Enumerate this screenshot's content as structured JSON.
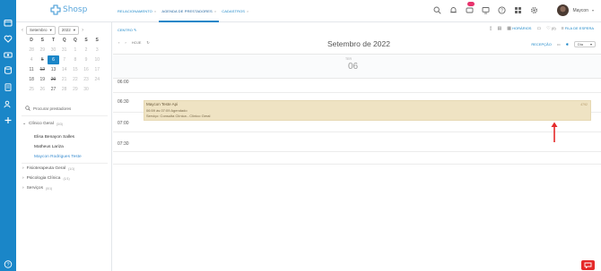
{
  "app": {
    "logo_text": "Shosp",
    "user_name": "Maycon"
  },
  "tabs": [
    {
      "label": "RELACIONAMENTO",
      "active": false
    },
    {
      "label": "AGENDA DE PRESTADORES",
      "active": true
    },
    {
      "label": "CADASTROS",
      "active": false
    }
  ],
  "top_icons": [
    "search-icon",
    "bell-icon",
    "chat-icon",
    "monitor-icon",
    "help-icon",
    "grid-icon",
    "settings-icon"
  ],
  "notification_badge": "",
  "rail_icons": [
    "calendar-icon",
    "heart-icon",
    "money-icon",
    "database-icon",
    "document-icon",
    "building-icon",
    "user-settings-icon",
    "plus-icon",
    "help-icon"
  ],
  "calendar": {
    "month": "Setembro",
    "year": "2022",
    "weekdays": [
      "D",
      "S",
      "T",
      "Q",
      "Q",
      "S",
      "S"
    ],
    "days": [
      {
        "d": "28",
        "cur": false
      },
      {
        "d": "29",
        "cur": false
      },
      {
        "d": "30",
        "cur": false
      },
      {
        "d": "31",
        "cur": false
      },
      {
        "d": "1",
        "cur": false
      },
      {
        "d": "2",
        "cur": false
      },
      {
        "d": "3",
        "cur": false
      },
      {
        "d": "4",
        "cur": false
      },
      {
        "d": "5",
        "cur": true,
        "strike": true
      },
      {
        "d": "6",
        "cur": true,
        "today": true
      },
      {
        "d": "7",
        "cur": false
      },
      {
        "d": "8",
        "cur": false
      },
      {
        "d": "9",
        "cur": false
      },
      {
        "d": "10",
        "cur": false
      },
      {
        "d": "11",
        "cur": true
      },
      {
        "d": "12",
        "cur": true,
        "strike": true
      },
      {
        "d": "13",
        "cur": true
      },
      {
        "d": "14",
        "cur": false
      },
      {
        "d": "15",
        "cur": false
      },
      {
        "d": "16",
        "cur": false
      },
      {
        "d": "17",
        "cur": false
      },
      {
        "d": "18",
        "cur": true
      },
      {
        "d": "19",
        "cur": true
      },
      {
        "d": "20",
        "cur": true,
        "strike": true
      },
      {
        "d": "21",
        "cur": false
      },
      {
        "d": "22",
        "cur": false
      },
      {
        "d": "23",
        "cur": false
      },
      {
        "d": "24",
        "cur": false
      },
      {
        "d": "25",
        "cur": false
      },
      {
        "d": "26",
        "cur": false
      },
      {
        "d": "27",
        "cur": true
      },
      {
        "d": "28",
        "cur": false
      },
      {
        "d": "29",
        "cur": false
      },
      {
        "d": "30",
        "cur": false
      },
      {
        "d": "",
        "cur": false
      }
    ]
  },
  "search": {
    "placeholder": "Procurar prestadores"
  },
  "groups": {
    "clinico": {
      "label": "Clínico Geral",
      "count": "(3/3)"
    },
    "fisio": {
      "label": "Fisioterapeuta Geral",
      "count": "(1/1)"
    },
    "psico": {
      "label": "Psicologia Clínica",
      "count": "(1/1)"
    },
    "servicos": {
      "label": "Serviços",
      "count": "(0/1)"
    }
  },
  "providers": [
    {
      "name": "Elisa Benayon Salles"
    },
    {
      "name": "Matheus Lariza"
    },
    {
      "name": "Maycon Rodrigues Teste"
    }
  ],
  "main": {
    "centro_label": "CENTRO",
    "hoje_label": "HOJE",
    "month_title": "Setembro de 2022",
    "horarios_label": "HORÁRIOS",
    "count_label": "(0)",
    "fila_label": "FILA DE ESPERA",
    "recepcao_label": "RECEPÇÃO",
    "view_select": "Dia",
    "day_name": "TER",
    "day_number": "06"
  },
  "time_slots": [
    "06:00",
    "06:30",
    "07:00",
    "07:30"
  ],
  "appointment": {
    "title": "Maycon Teste Api",
    "time_status": "06:59 às 07:09 Agendado",
    "service": "Serviço: Consulta Clínica - Clínico Geral",
    "code": "4792"
  },
  "colors": {
    "brand": "#1a86c8",
    "appointment_bg": "#efe3c3",
    "annotation_arrow": "#e52a2a",
    "badge": "#e8336d"
  }
}
